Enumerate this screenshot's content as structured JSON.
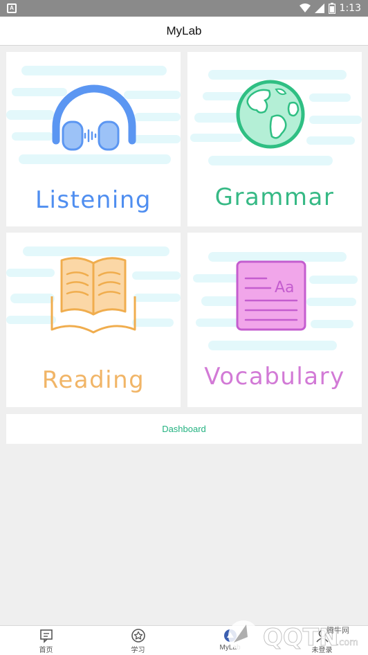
{
  "status_bar": {
    "time": "1:13"
  },
  "app_bar": {
    "title": "MyLab"
  },
  "cards": {
    "listening": {
      "label": "Listening",
      "color": "#4f8ef0"
    },
    "grammar": {
      "label": "Grammar",
      "color": "#36b985"
    },
    "reading": {
      "label": "Reading",
      "color": "#f1b567"
    },
    "vocabulary": {
      "label": "Vocabulary",
      "color": "#d27ad6"
    }
  },
  "dashboard": {
    "label": "Dashboard",
    "color": "#23b280"
  },
  "bottom_nav": {
    "items": [
      {
        "label": "首页",
        "icon": "home-chat-icon"
      },
      {
        "label": "学习",
        "icon": "star-circle-icon"
      },
      {
        "label": "MyLab",
        "icon": "mylab-icon"
      },
      {
        "label": "未登录",
        "icon": "profile-icon"
      }
    ]
  }
}
